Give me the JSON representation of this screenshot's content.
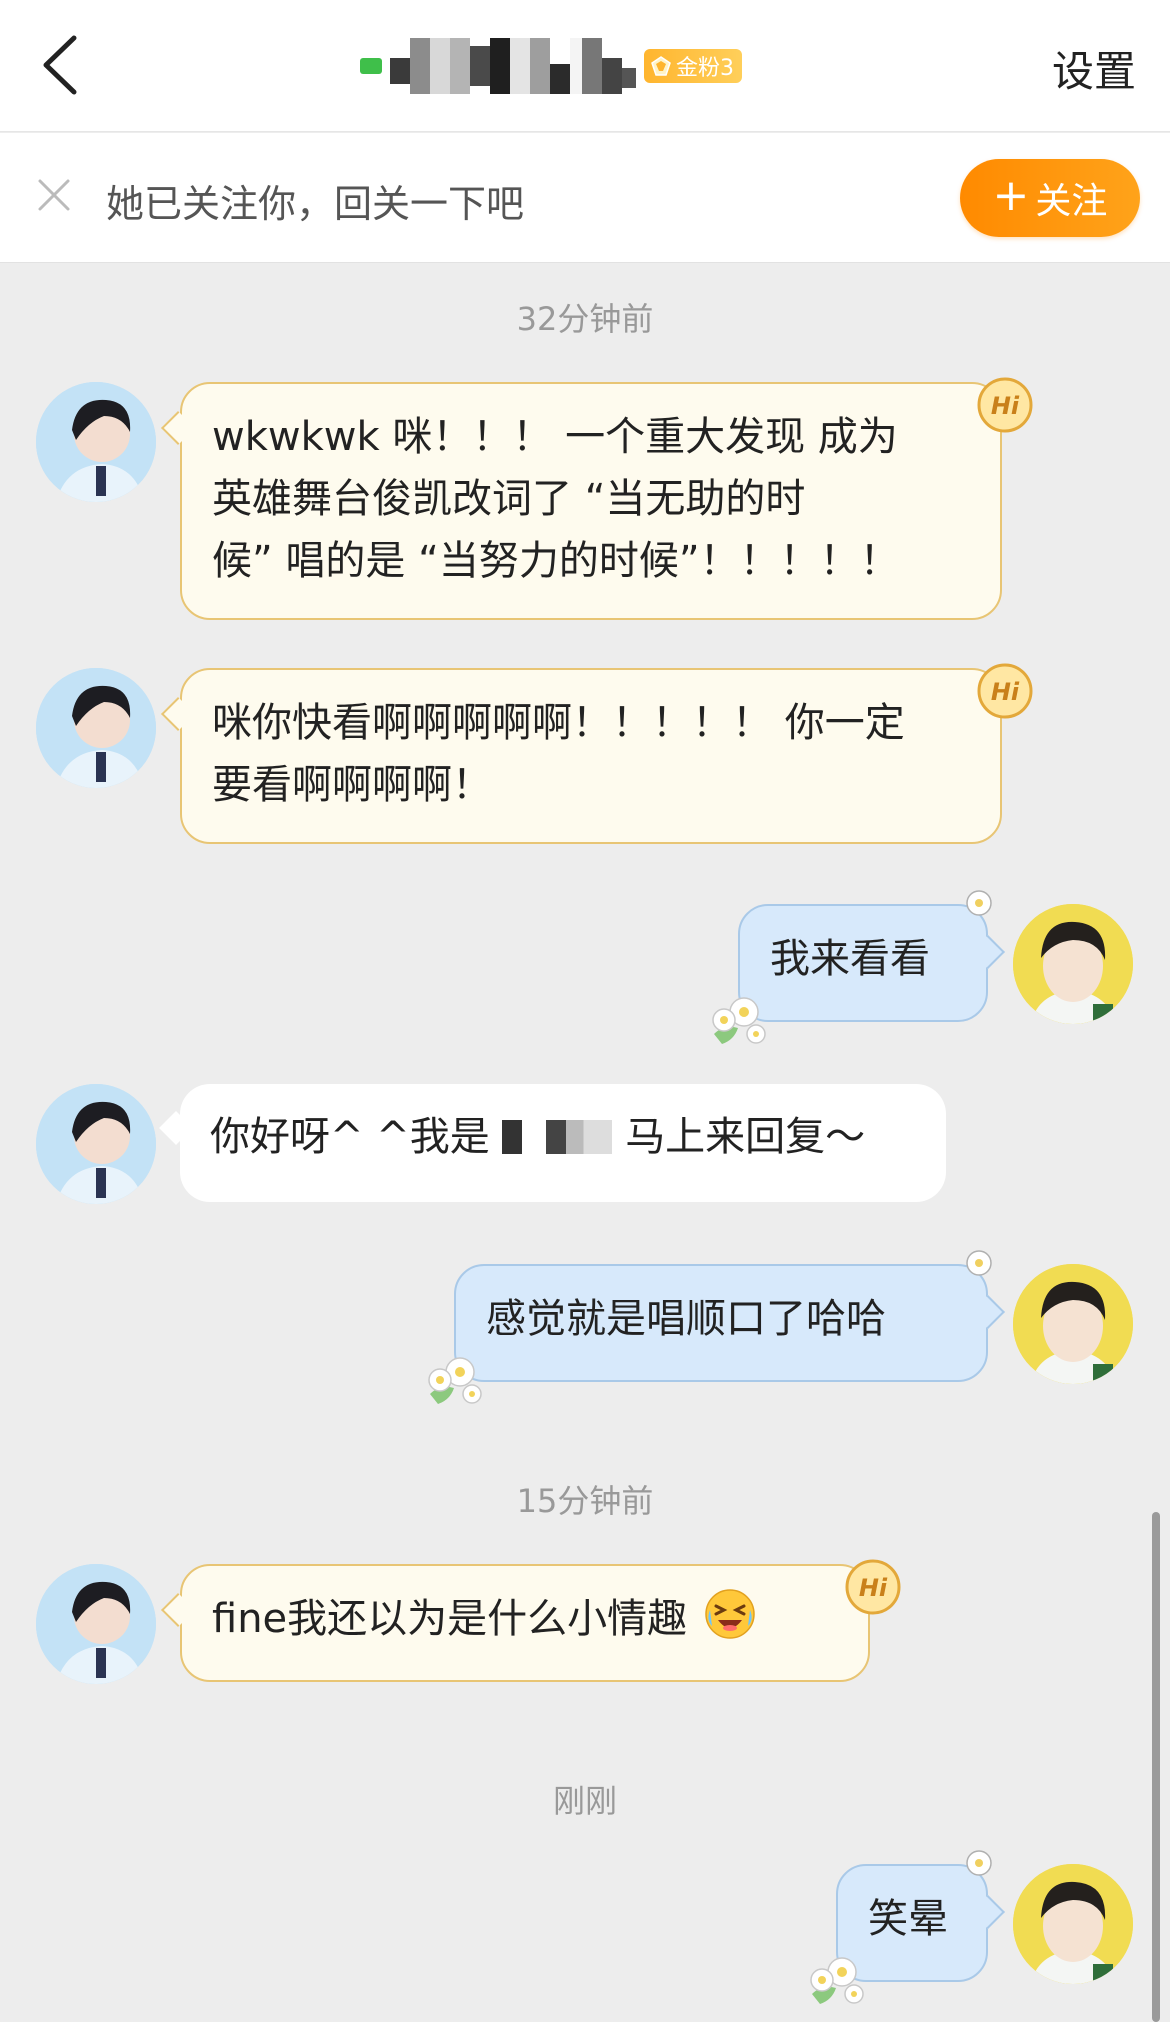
{
  "header": {
    "back_label": "back",
    "badge_label": "金粉3",
    "settings_label": "设置"
  },
  "follow_bar": {
    "message": "她已关注你，回关一下吧",
    "follow_label": "关注"
  },
  "timestamps": [
    "32分钟前",
    "15分钟前",
    "刚刚"
  ],
  "messages": [
    {
      "sender": "other",
      "style": "hi",
      "lines": [
        "wkwkwk 咪！！！ 一个重大发现 成为",
        "英雄舞台俊凯改词了 “当无助的时",
        "候” 唱的是 “当努力的时候”！！！！！"
      ]
    },
    {
      "sender": "other",
      "style": "hi",
      "lines": [
        "咪你快看啊啊啊啊啊！！！！！ 你一定",
        "要看啊啊啊啊！"
      ]
    },
    {
      "sender": "me",
      "text": "我来看看"
    },
    {
      "sender": "other",
      "style": "plain",
      "text_pre": "你好呀^ ^我是",
      "text_post": "马上来回复～"
    },
    {
      "sender": "me",
      "text": "感觉就是唱顺口了哈哈"
    },
    {
      "sender": "other",
      "style": "hi",
      "text": "fine我还以为是什么小情趣"
    },
    {
      "sender": "me",
      "text": "笑晕"
    }
  ],
  "colors": {
    "accent_orange": "#ff8a00",
    "bubble_hi_bg": "#fefbee",
    "bubble_hi_border": "#e8c574",
    "bubble_me_bg": "#d7e9fb",
    "bubble_me_border": "#a9c9e8",
    "background": "#ededed"
  }
}
